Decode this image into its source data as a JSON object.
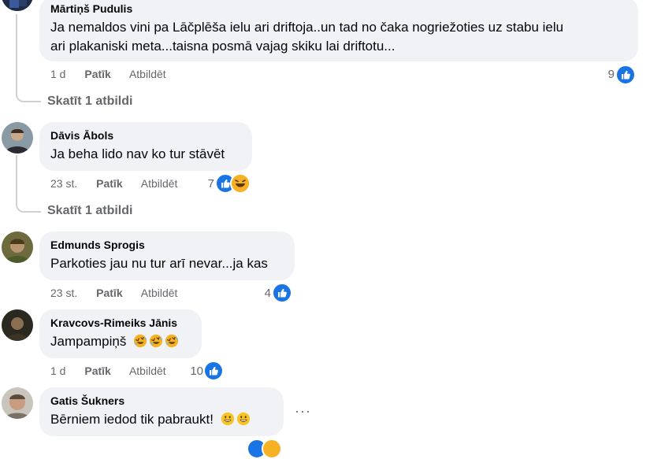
{
  "colors": {
    "bubble": "#f0f2f5",
    "meta_text": "#65676b",
    "like_blue": "#1b74e4",
    "haha_yellow": "#f7b125",
    "thread_line": "#ced0d4"
  },
  "comments": [
    {
      "author": "Mārtiņš Pudulis",
      "text_line1": "Ja nemaldos vini pa Lāčplēša ielu ari driftoja..un tad no čaka nogriežoties uz stabu ielu",
      "text_line2": "ari plakaniski meta...taisna posmā vajag skiku lai driftotu...",
      "time": "1 d",
      "like_label": "Patīk",
      "reply_label": "Atbildēt",
      "reaction_count": "9",
      "reactions": [
        "like-icon"
      ],
      "view_replies": "Skatīt 1 atbildi"
    },
    {
      "author": "Dāvis Ābols",
      "text": "Ja beha lido nav ko tur stāvēt",
      "time": "23 st.",
      "like_label": "Patīk",
      "reply_label": "Atbildēt",
      "reaction_count": "7",
      "reactions": [
        "like-icon",
        "haha-icon"
      ],
      "view_replies": "Skatīt 1 atbildi"
    },
    {
      "author": "Edmunds Sprogis",
      "text": "Parkoties jau nu tur arī nevar...ja kas",
      "time": "23 st.",
      "like_label": "Patīk",
      "reply_label": "Atbildēt",
      "reaction_count": "4",
      "reactions": [
        "like-icon"
      ]
    },
    {
      "author": "Kravcovs-Rimeiks Jānis",
      "text": "Jampampiņš",
      "text_emojis": [
        "rofl-emoji",
        "rofl-emoji",
        "rofl-emoji"
      ],
      "time": "1 d",
      "like_label": "Patīk",
      "reply_label": "Atbildēt",
      "reaction_count": "10",
      "reactions": [
        "like-icon"
      ]
    },
    {
      "author": "Gatis Šukners",
      "text": "Bērniem iedod tik pabraukt!",
      "text_emojis": [
        "smile-emoji",
        "smile-emoji"
      ],
      "more_label": "···"
    }
  ]
}
